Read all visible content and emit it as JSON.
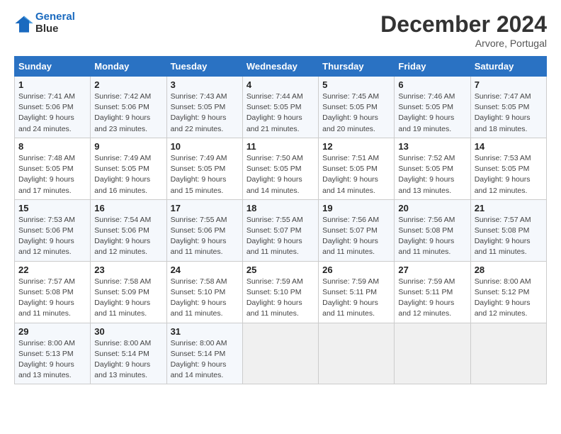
{
  "header": {
    "logo_line1": "General",
    "logo_line2": "Blue",
    "month": "December 2024",
    "location": "Arvore, Portugal"
  },
  "weekdays": [
    "Sunday",
    "Monday",
    "Tuesday",
    "Wednesday",
    "Thursday",
    "Friday",
    "Saturday"
  ],
  "weeks": [
    [
      {
        "day": "1",
        "sunrise": "7:41 AM",
        "sunset": "5:06 PM",
        "daylight": "9 hours and 24 minutes."
      },
      {
        "day": "2",
        "sunrise": "7:42 AM",
        "sunset": "5:06 PM",
        "daylight": "9 hours and 23 minutes."
      },
      {
        "day": "3",
        "sunrise": "7:43 AM",
        "sunset": "5:05 PM",
        "daylight": "9 hours and 22 minutes."
      },
      {
        "day": "4",
        "sunrise": "7:44 AM",
        "sunset": "5:05 PM",
        "daylight": "9 hours and 21 minutes."
      },
      {
        "day": "5",
        "sunrise": "7:45 AM",
        "sunset": "5:05 PM",
        "daylight": "9 hours and 20 minutes."
      },
      {
        "day": "6",
        "sunrise": "7:46 AM",
        "sunset": "5:05 PM",
        "daylight": "9 hours and 19 minutes."
      },
      {
        "day": "7",
        "sunrise": "7:47 AM",
        "sunset": "5:05 PM",
        "daylight": "9 hours and 18 minutes."
      }
    ],
    [
      {
        "day": "8",
        "sunrise": "7:48 AM",
        "sunset": "5:05 PM",
        "daylight": "9 hours and 17 minutes."
      },
      {
        "day": "9",
        "sunrise": "7:49 AM",
        "sunset": "5:05 PM",
        "daylight": "9 hours and 16 minutes."
      },
      {
        "day": "10",
        "sunrise": "7:49 AM",
        "sunset": "5:05 PM",
        "daylight": "9 hours and 15 minutes."
      },
      {
        "day": "11",
        "sunrise": "7:50 AM",
        "sunset": "5:05 PM",
        "daylight": "9 hours and 14 minutes."
      },
      {
        "day": "12",
        "sunrise": "7:51 AM",
        "sunset": "5:05 PM",
        "daylight": "9 hours and 14 minutes."
      },
      {
        "day": "13",
        "sunrise": "7:52 AM",
        "sunset": "5:05 PM",
        "daylight": "9 hours and 13 minutes."
      },
      {
        "day": "14",
        "sunrise": "7:53 AM",
        "sunset": "5:05 PM",
        "daylight": "9 hours and 12 minutes."
      }
    ],
    [
      {
        "day": "15",
        "sunrise": "7:53 AM",
        "sunset": "5:06 PM",
        "daylight": "9 hours and 12 minutes."
      },
      {
        "day": "16",
        "sunrise": "7:54 AM",
        "sunset": "5:06 PM",
        "daylight": "9 hours and 12 minutes."
      },
      {
        "day": "17",
        "sunrise": "7:55 AM",
        "sunset": "5:06 PM",
        "daylight": "9 hours and 11 minutes."
      },
      {
        "day": "18",
        "sunrise": "7:55 AM",
        "sunset": "5:07 PM",
        "daylight": "9 hours and 11 minutes."
      },
      {
        "day": "19",
        "sunrise": "7:56 AM",
        "sunset": "5:07 PM",
        "daylight": "9 hours and 11 minutes."
      },
      {
        "day": "20",
        "sunrise": "7:56 AM",
        "sunset": "5:08 PM",
        "daylight": "9 hours and 11 minutes."
      },
      {
        "day": "21",
        "sunrise": "7:57 AM",
        "sunset": "5:08 PM",
        "daylight": "9 hours and 11 minutes."
      }
    ],
    [
      {
        "day": "22",
        "sunrise": "7:57 AM",
        "sunset": "5:08 PM",
        "daylight": "9 hours and 11 minutes."
      },
      {
        "day": "23",
        "sunrise": "7:58 AM",
        "sunset": "5:09 PM",
        "daylight": "9 hours and 11 minutes."
      },
      {
        "day": "24",
        "sunrise": "7:58 AM",
        "sunset": "5:10 PM",
        "daylight": "9 hours and 11 minutes."
      },
      {
        "day": "25",
        "sunrise": "7:59 AM",
        "sunset": "5:10 PM",
        "daylight": "9 hours and 11 minutes."
      },
      {
        "day": "26",
        "sunrise": "7:59 AM",
        "sunset": "5:11 PM",
        "daylight": "9 hours and 11 minutes."
      },
      {
        "day": "27",
        "sunrise": "7:59 AM",
        "sunset": "5:11 PM",
        "daylight": "9 hours and 12 minutes."
      },
      {
        "day": "28",
        "sunrise": "8:00 AM",
        "sunset": "5:12 PM",
        "daylight": "9 hours and 12 minutes."
      }
    ],
    [
      {
        "day": "29",
        "sunrise": "8:00 AM",
        "sunset": "5:13 PM",
        "daylight": "9 hours and 13 minutes."
      },
      {
        "day": "30",
        "sunrise": "8:00 AM",
        "sunset": "5:14 PM",
        "daylight": "9 hours and 13 minutes."
      },
      {
        "day": "31",
        "sunrise": "8:00 AM",
        "sunset": "5:14 PM",
        "daylight": "9 hours and 14 minutes."
      },
      null,
      null,
      null,
      null
    ]
  ]
}
